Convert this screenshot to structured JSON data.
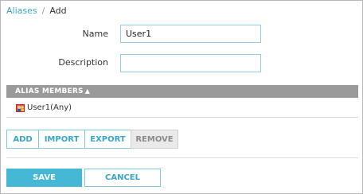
{
  "breadcrumb": {
    "parent": "Aliases",
    "separator": "/",
    "current": "Add"
  },
  "form": {
    "name_label": "Name",
    "name_value": "User1",
    "description_label": "Description",
    "description_value": ""
  },
  "table": {
    "header": "ALIAS MEMBERS",
    "sort_icon": "sort-asc-icon",
    "rows": [
      {
        "icon": "user-icon",
        "label": "User1(Any)"
      }
    ]
  },
  "actions": {
    "add": "ADD",
    "import": "IMPORT",
    "export": "EXPORT",
    "remove": "REMOVE"
  },
  "footer": {
    "save": "SAVE",
    "cancel": "CANCEL"
  },
  "colors": {
    "accent": "#3aa6c9",
    "save_bg": "#44b8d4",
    "header_bg": "#9a9a9a",
    "disabled_bg": "#eaeaea"
  }
}
